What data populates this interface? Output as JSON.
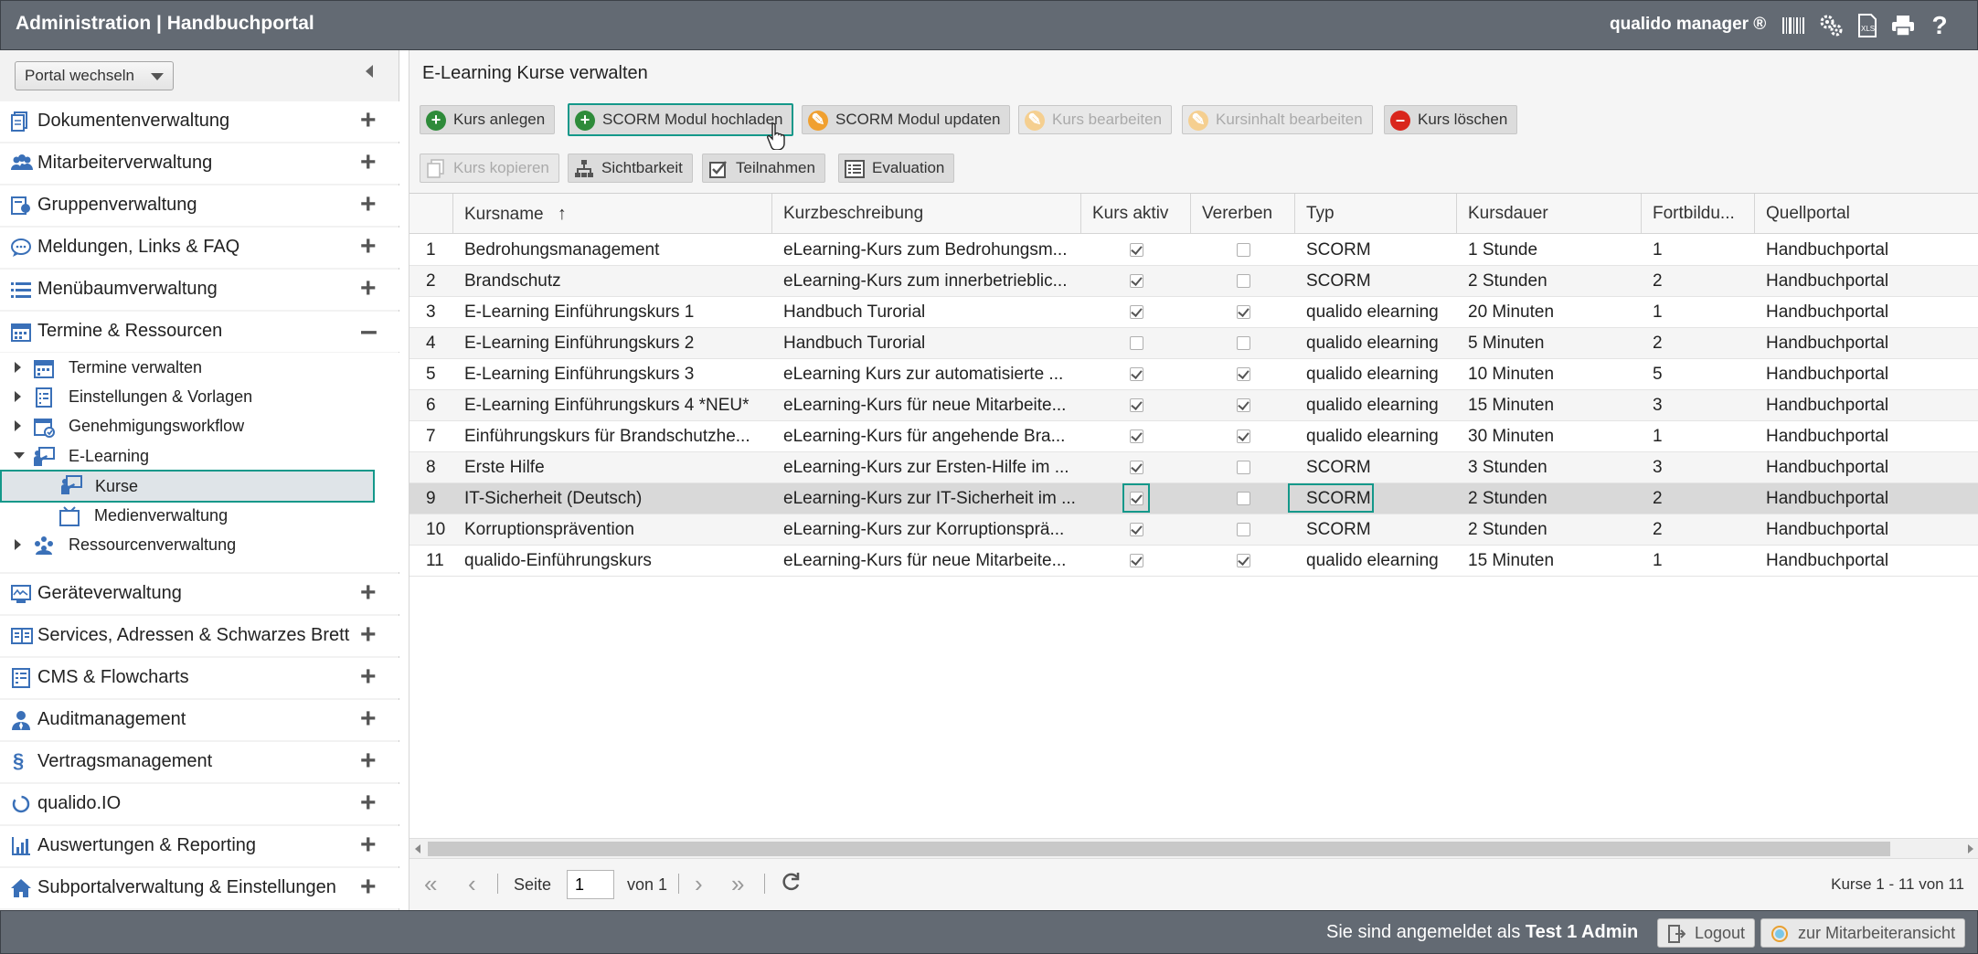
{
  "topbar": {
    "title": "Administration | Handbuchportal",
    "product": "qualido manager ®",
    "icons": [
      "barcode-icon",
      "settings-gears-icon",
      "xls-export-icon",
      "print-icon",
      "help-icon"
    ]
  },
  "sidebar": {
    "portal_switch": "Portal wechseln",
    "items_top": [
      {
        "label": "Dokumentenverwaltung",
        "icon": "documents-icon"
      },
      {
        "label": "Mitarbeiterverwaltung",
        "icon": "users-icon"
      },
      {
        "label": "Gruppenverwaltung",
        "icon": "groups-icon"
      },
      {
        "label": "Meldungen, Links & FAQ",
        "icon": "speech-bubble-icon"
      },
      {
        "label": "Menübaumverwaltung",
        "icon": "list-icon"
      },
      {
        "label": "Termine & Ressourcen",
        "icon": "calendar-icon"
      }
    ],
    "tree": [
      {
        "label": "Termine verwalten",
        "icon": "calendar-icon"
      },
      {
        "label": "Einstellungen & Vorlagen",
        "icon": "template-icon"
      },
      {
        "label": "Genehmigungsworkflow",
        "icon": "approval-icon"
      },
      {
        "label": "E-Learning",
        "icon": "teacher-icon"
      },
      {
        "label": "Kurse",
        "icon": "teacher-icon"
      },
      {
        "label": "Medienverwaltung",
        "icon": "media-icon"
      },
      {
        "label": "Ressourcenverwaltung",
        "icon": "resources-icon"
      }
    ],
    "items_bottom": [
      {
        "label": "Geräteverwaltung",
        "icon": "device-icon"
      },
      {
        "label": "Services, Adressen & Schwarzes Brett",
        "icon": "address-book-icon"
      },
      {
        "label": "CMS & Flowcharts",
        "icon": "cms-icon"
      },
      {
        "label": "Auditmanagement",
        "icon": "auditor-icon"
      },
      {
        "label": "Vertragsmanagement",
        "icon": "paragraph-icon"
      },
      {
        "label": "qualido.IO",
        "icon": "io-icon"
      },
      {
        "label": "Auswertungen & Reporting",
        "icon": "bar-chart-icon"
      },
      {
        "label": "Subportalverwaltung & Einstellungen",
        "icon": "home-icon"
      }
    ]
  },
  "main": {
    "title": "E-Learning Kurse verwalten",
    "toolbar_row1": [
      {
        "label": "Kurs anlegen",
        "icon": "plus-green-icon",
        "enabled": true
      },
      {
        "label": "SCORM Modul hochladen",
        "icon": "plus-green-icon",
        "enabled": true
      },
      {
        "label": "SCORM Modul updaten",
        "icon": "pencil-orange-icon",
        "enabled": true
      },
      {
        "label": "Kurs bearbeiten",
        "icon": "pencil-orange-icon",
        "enabled": false
      },
      {
        "label": "Kursinhalt bearbeiten",
        "icon": "pencil-orange-icon",
        "enabled": false
      },
      {
        "label": "Kurs löschen",
        "icon": "minus-red-icon",
        "enabled": true
      }
    ],
    "toolbar_row2": [
      {
        "label": "Kurs kopieren",
        "icon": "copy-icon",
        "enabled": false
      },
      {
        "label": "Sichtbarkeit",
        "icon": "hierarchy-icon",
        "enabled": true
      },
      {
        "label": "Teilnahmen",
        "icon": "checkbox-icon",
        "enabled": true
      },
      {
        "label": "Evaluation",
        "icon": "evaluation-icon",
        "enabled": true
      }
    ],
    "columns": [
      "",
      "Kursname",
      "Kurzbeschreibung",
      "Kurs aktiv",
      "Vererben",
      "Typ",
      "Kursdauer",
      "Fortbildu...",
      "Quellportal"
    ],
    "rows": [
      {
        "n": "1",
        "name": "Bedrohungsmanagement",
        "desc": "eLearning-Kurs zum Bedrohungsm...",
        "active": true,
        "inherit": false,
        "type": "SCORM",
        "duration": "1 Stunde",
        "fort": "1",
        "source": "Handbuchportal"
      },
      {
        "n": "2",
        "name": "Brandschutz",
        "desc": "eLearning-Kurs zum innerbetrieblic...",
        "active": true,
        "inherit": false,
        "type": "SCORM",
        "duration": "2 Stunden",
        "fort": "2",
        "source": "Handbuchportal"
      },
      {
        "n": "3",
        "name": "E-Learning Einführungskurs 1",
        "desc": "Handbuch Turorial",
        "active": true,
        "inherit": true,
        "type": "qualido elearning",
        "duration": "20 Minuten",
        "fort": "1",
        "source": "Handbuchportal"
      },
      {
        "n": "4",
        "name": "E-Learning Einführungskurs 2",
        "desc": "Handbuch Turorial",
        "active": false,
        "inherit": false,
        "type": "qualido elearning",
        "duration": "5 Minuten",
        "fort": "2",
        "source": "Handbuchportal"
      },
      {
        "n": "5",
        "name": "E-Learning Einführungskurs 3",
        "desc": "eLearning Kurs zur automatisierte ...",
        "active": true,
        "inherit": true,
        "type": "qualido elearning",
        "duration": "10 Minuten",
        "fort": "5",
        "source": "Handbuchportal"
      },
      {
        "n": "6",
        "name": "E-Learning Einführungskurs 4 *NEU*",
        "desc": "eLearning-Kurs für neue Mitarbeite...",
        "active": true,
        "inherit": true,
        "type": "qualido elearning",
        "duration": "15 Minuten",
        "fort": "3",
        "source": "Handbuchportal"
      },
      {
        "n": "7",
        "name": "Einführungskurs für Brandschutzhe...",
        "desc": "eLearning-Kurs für angehende Bra...",
        "active": true,
        "inherit": true,
        "type": "qualido elearning",
        "duration": "30 Minuten",
        "fort": "1",
        "source": "Handbuchportal"
      },
      {
        "n": "8",
        "name": "Erste Hilfe",
        "desc": "eLearning-Kurs zur Ersten-Hilfe im ...",
        "active": true,
        "inherit": false,
        "type": "SCORM",
        "duration": "3 Stunden",
        "fort": "3",
        "source": "Handbuchportal"
      },
      {
        "n": "9",
        "name": "IT-Sicherheit (Deutsch)",
        "desc": "eLearning-Kurs zur IT-Sicherheit im ...",
        "active": true,
        "inherit": false,
        "type": "SCORM",
        "duration": "2 Stunden",
        "fort": "2",
        "source": "Handbuchportal"
      },
      {
        "n": "10",
        "name": "Korruptionsprävention",
        "desc": "eLearning-Kurs zur Korruptionsprä...",
        "active": true,
        "inherit": false,
        "type": "SCORM",
        "duration": "2 Stunden",
        "fort": "2",
        "source": "Handbuchportal"
      },
      {
        "n": "11",
        "name": "qualido-Einführungskurs",
        "desc": "eLearning-Kurs für neue Mitarbeite...",
        "active": true,
        "inherit": true,
        "type": "qualido elearning",
        "duration": "15 Minuten",
        "fort": "1",
        "source": "Handbuchportal"
      }
    ],
    "selected_row": "9",
    "pager": {
      "page_label": "Seite",
      "page_value": "1",
      "of_label": "von 1",
      "summary": "Kurse 1 - 11 von 11"
    }
  },
  "footer": {
    "logged_in_prefix": "Sie sind angemeldet als",
    "user": "Test 1 Admin",
    "logout": "Logout",
    "employee_view": "zur Mitarbeiteransicht"
  },
  "colors": {
    "header_bg": "#636a73",
    "highlight": "#14988a",
    "plus_green": "#2e8b3a",
    "pencil_orange": "#f0a030",
    "minus_red": "#d9261c",
    "icon_blue": "#3a70b8"
  }
}
